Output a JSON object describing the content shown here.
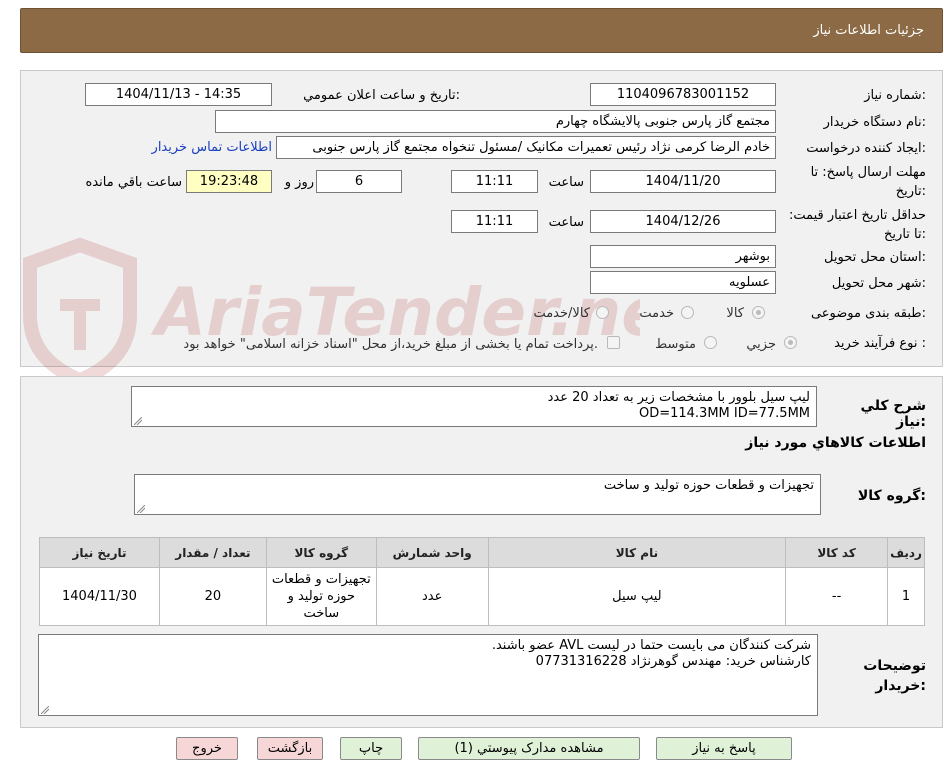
{
  "header": {
    "title": "جزئیات اطلاعات نیاز"
  },
  "watermark": {
    "text": "AriaTender.neT"
  },
  "form": {
    "need_number_label": "شماره نیاز:",
    "need_number": "1104096783001152",
    "announce_label": "تاریخ و ساعت اعلان عمومي:",
    "announce_value": "1404/11/13 - 14:35",
    "buyer_label": "نام دستگاه خریدار:",
    "buyer_value": "مجتمع گاز پارس جنوبی  پالایشگاه چهارم",
    "requester_label": "ایجاد کننده درخواست:",
    "requester_value": "خادم الرضا کرمی نژاد رئیس تعمیرات مکانیک /مسئول تنخواه مجتمع گاز پارس جنوبی",
    "contact_link": "اطلاعات تماس خریدار",
    "deadline_label": "مهلت ارسال پاسخ: تا تاریخ:",
    "deadline_date": "1404/11/20",
    "time_label": "ساعت",
    "deadline_time": "11:11",
    "days_value": "6",
    "days_label": "روز و",
    "remaining_time": "19:23:48",
    "remaining_label": "ساعت باقي مانده",
    "validity_label": "حداقل تاریخ اعتبار قیمت: تا تاریخ:",
    "validity_date": "1404/12/26",
    "validity_time": "11:11",
    "province_label": "استان محل تحویل:",
    "province_value": "بوشهر",
    "city_label": "شهر محل تحویل:",
    "city_value": "عسلویه",
    "category_label": "طبقه بندی موضوعی:",
    "category_options": [
      "کالا",
      "خدمت",
      "کالا/خدمت"
    ],
    "purchase_label": "نوع فرآیند خرید :",
    "purchase_options": [
      "جزيي",
      "متوسط"
    ],
    "payment_note": "پرداخت تمام یا بخشی از مبلغ خرید،از محل \"اسناد خزانه اسلامی\" خواهد بود."
  },
  "description": {
    "label": "شرح كلي نياز:",
    "line1": "لیپ سیل بلوور با مشخصات زیر به تعداد 20 عدد",
    "line2": "OD=114.3MM    ID=77.5MM"
  },
  "goods_section": {
    "title": "اطلاعات كالاهاي مورد نياز",
    "group_label": "گروه کالا:",
    "group_value": "تجهیزات و قطعات حوزه تولید و ساخت"
  },
  "table": {
    "headers": [
      "ردیف",
      "کد کالا",
      "نام کالا",
      "واحد شمارش",
      "گروه کالا",
      "تعداد / مقدار",
      "تاریخ نیاز"
    ],
    "rows": [
      {
        "index": "1",
        "code": "--",
        "name": "لیپ سیل",
        "unit": "عدد",
        "group": "تجهیزات و قطعات حوزه تولید و ساخت",
        "qty": "20",
        "date": "1404/11/30"
      }
    ]
  },
  "notes": {
    "label": "توضیحات خریدار:",
    "line1": "شرکت کنندگان می بایست حتما در لیست AVL عضو باشند.",
    "line2": "کارشناس خرید: مهندس گوهرنژاد 07731316228"
  },
  "buttons": {
    "reply": "پاسخ به نیاز",
    "attachments": "مشاهده مدارک پیوستي (1)",
    "print": "چاپ",
    "back": "بازگشت",
    "exit": "خروج"
  }
}
